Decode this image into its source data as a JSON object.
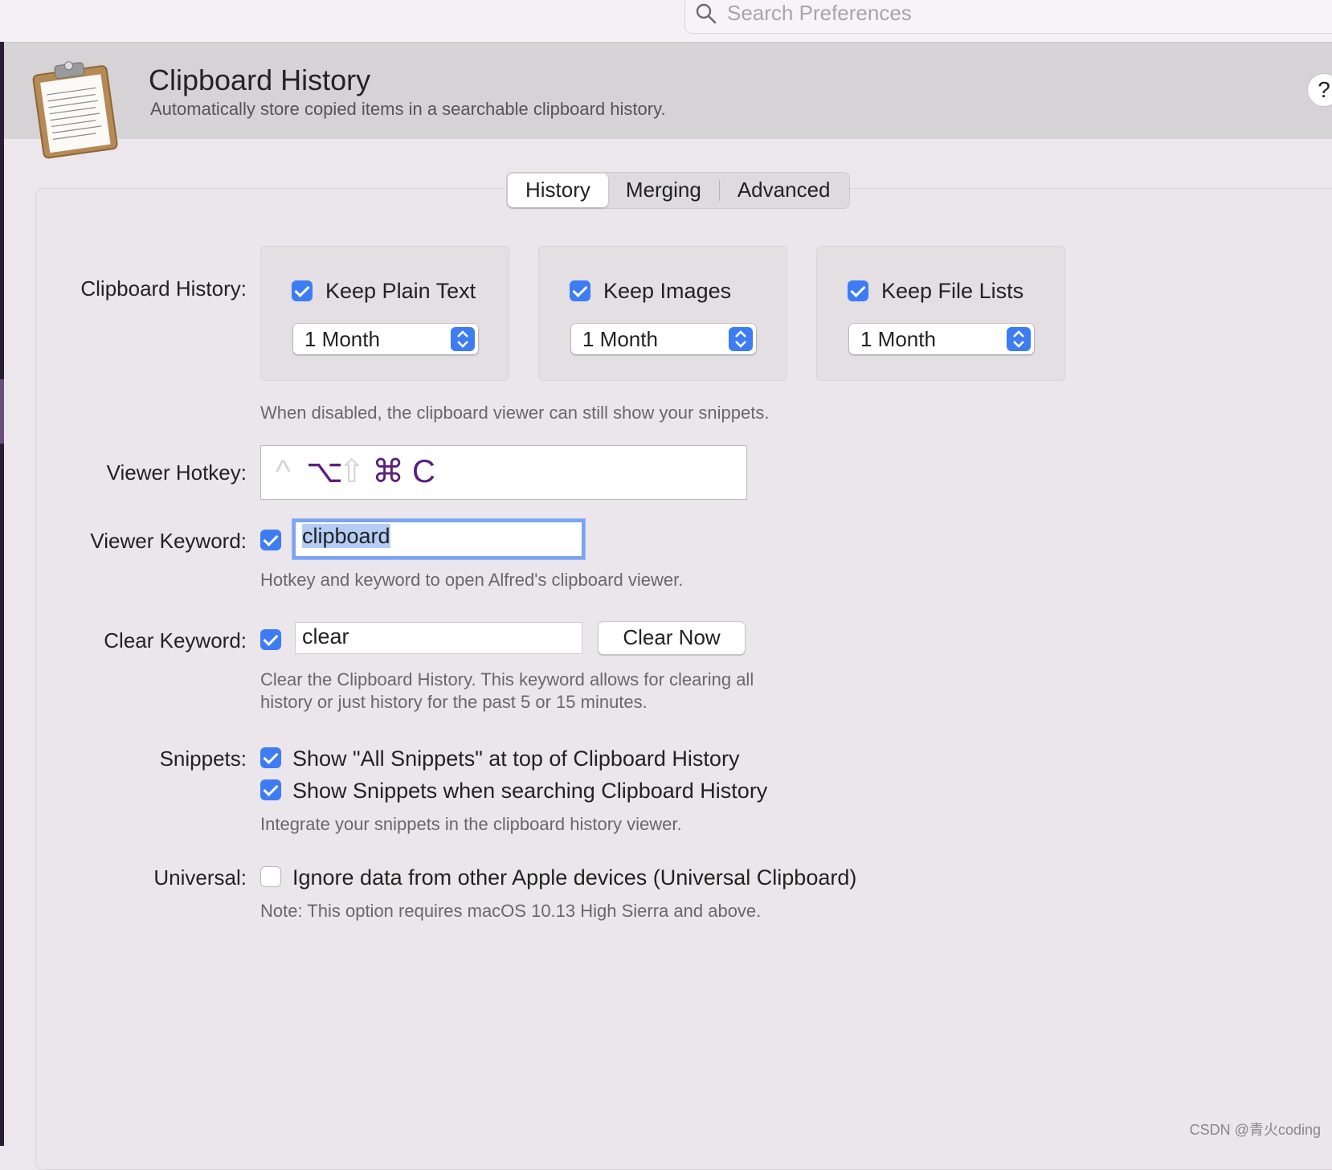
{
  "search": {
    "placeholder": "Search Preferences"
  },
  "header": {
    "title": "Clipboard History",
    "subtitle": "Automatically store copied items in a searchable clipboard history.",
    "help_label": "?"
  },
  "tabs": [
    {
      "label": "History",
      "active": true
    },
    {
      "label": "Merging",
      "active": false
    },
    {
      "label": "Advanced",
      "active": false
    }
  ],
  "clipboard_history": {
    "label": "Clipboard History:",
    "groups": [
      {
        "label": "Keep Plain Text",
        "checked": true,
        "duration": "1 Month"
      },
      {
        "label": "Keep Images",
        "checked": true,
        "duration": "1 Month"
      },
      {
        "label": "Keep File Lists",
        "checked": true,
        "duration": "1 Month"
      }
    ],
    "help": "When disabled, the clipboard viewer can still show your snippets."
  },
  "viewer_hotkey": {
    "label": "Viewer Hotkey:",
    "keys": [
      {
        "symbol": "^",
        "active": false
      },
      {
        "symbol": "⌥",
        "active": true
      },
      {
        "symbol": "⇧",
        "active": false
      },
      {
        "symbol": "⌘",
        "active": true
      },
      {
        "symbol": "C",
        "active": true
      }
    ]
  },
  "viewer_keyword": {
    "label": "Viewer Keyword:",
    "checked": true,
    "value": "clipboard",
    "help": "Hotkey and keyword to open Alfred's clipboard viewer."
  },
  "clear_keyword": {
    "label": "Clear Keyword:",
    "checked": true,
    "value": "clear",
    "button_label": "Clear Now",
    "help_line1": "Clear the Clipboard History. This keyword allows for clearing all",
    "help_line2": "history or just history for the past 5 or 15 minutes."
  },
  "snippets": {
    "label": "Snippets:",
    "options": [
      {
        "label": "Show \"All Snippets\" at top of Clipboard History",
        "checked": true
      },
      {
        "label": "Show Snippets when searching Clipboard History",
        "checked": true
      }
    ],
    "help": "Integrate your snippets in the clipboard history viewer."
  },
  "universal": {
    "label": "Universal:",
    "option": {
      "label": "Ignore data from other Apple devices (Universal Clipboard)",
      "checked": false
    },
    "help": "Note: This option requires macOS 10.13 High Sierra and above."
  },
  "watermark": "CSDN @青火coding",
  "colors": {
    "accent": "#3d7cf3",
    "hotkey_active": "#5c1f7a",
    "focus_ring": "#7aa3f3"
  }
}
